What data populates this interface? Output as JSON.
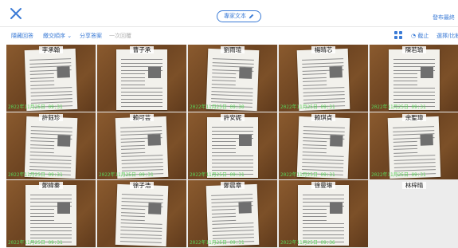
{
  "header": {
    "title": "專家文本",
    "publish": "發布最終"
  },
  "toolbar": {
    "hide_answer": "隱藏回答",
    "sort_order": "繳交順序",
    "share_answer": "分享答案",
    "one_click_return": "一次回覆",
    "stop": "截止",
    "select_compare": "選擇/比較"
  },
  "students": [
    {
      "name": "李承翰",
      "timestamp": "2022年11月25日 09:31"
    },
    {
      "name": "曹子承",
      "timestamp": ""
    },
    {
      "name": "劉雨瑄",
      "timestamp": "2022年11月25日 09:30"
    },
    {
      "name": "楊晴芯",
      "timestamp": "2022年11月25日 09:31"
    },
    {
      "name": "陳若瑜",
      "timestamp": "2022年11月25日 09:31"
    },
    {
      "name": "許鈺珍",
      "timestamp": "2022年11月25日 09:31"
    },
    {
      "name": "賴可芸",
      "timestamp": "2022年11月25日 09:31"
    },
    {
      "name": "許安妮",
      "timestamp": "2022年11月25日 09:31"
    },
    {
      "name": "賴琪貞",
      "timestamp": "2022年11月25日 09:31"
    },
    {
      "name": "余聖瑋",
      "timestamp": "2022年11月25日 09:31"
    },
    {
      "name": "鄭緯秦",
      "timestamp": "2022年11月25日 09:31"
    },
    {
      "name": "徐子浩",
      "timestamp": ""
    },
    {
      "name": "鄭晨章",
      "timestamp": "2022年11月25日 09:31"
    },
    {
      "name": "徐曼琳",
      "timestamp": "2022年11月25日 09:36"
    },
    {
      "name": "林梓晴",
      "timestamp": ""
    }
  ]
}
